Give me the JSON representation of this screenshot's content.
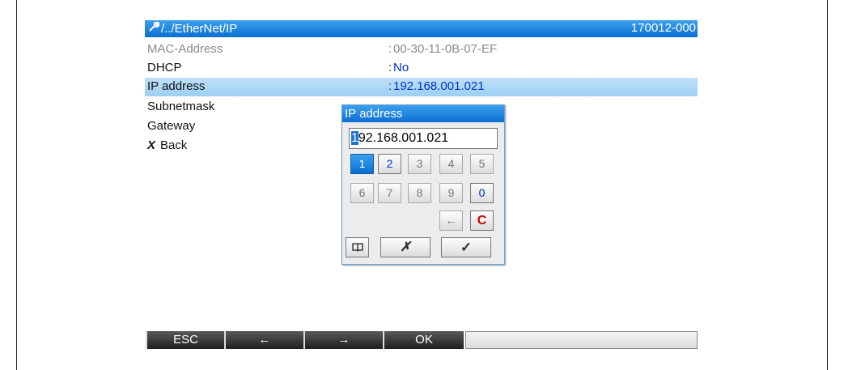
{
  "header": {
    "path": "/../EtherNet/IP",
    "code": "170012-000",
    "icon": "wrench-icon"
  },
  "rows": [
    {
      "label": "MAC-Address",
      "sep": ":",
      "value": "00-30-11-0B-07-EF"
    },
    {
      "label": "DHCP",
      "sep": ":",
      "value": "No"
    },
    {
      "label": "IP address",
      "sep": ":",
      "value": "192.168.001.021"
    },
    {
      "label": "Subnetmask"
    },
    {
      "label": "Gateway"
    },
    {
      "label": "Back",
      "icon": "x-icon"
    }
  ],
  "dialog": {
    "title": "IP address",
    "input": {
      "cursor_char": "1",
      "rest": "92.168.001.021"
    },
    "keys": [
      "1",
      "2",
      "3",
      "4",
      "5",
      "6",
      "7",
      "8",
      "9",
      "0"
    ],
    "backspace": "←",
    "clear": "C",
    "book_icon": "book-icon",
    "cancel": "✗",
    "confirm": "✓"
  },
  "footer": {
    "esc": "ESC",
    "left": "←",
    "right": "→",
    "ok": "OK"
  },
  "colors": {
    "accent": "#0a6fd1",
    "selection": "#9ccff2",
    "value_blue": "#0033cc",
    "clear_red": "#cc0000"
  }
}
